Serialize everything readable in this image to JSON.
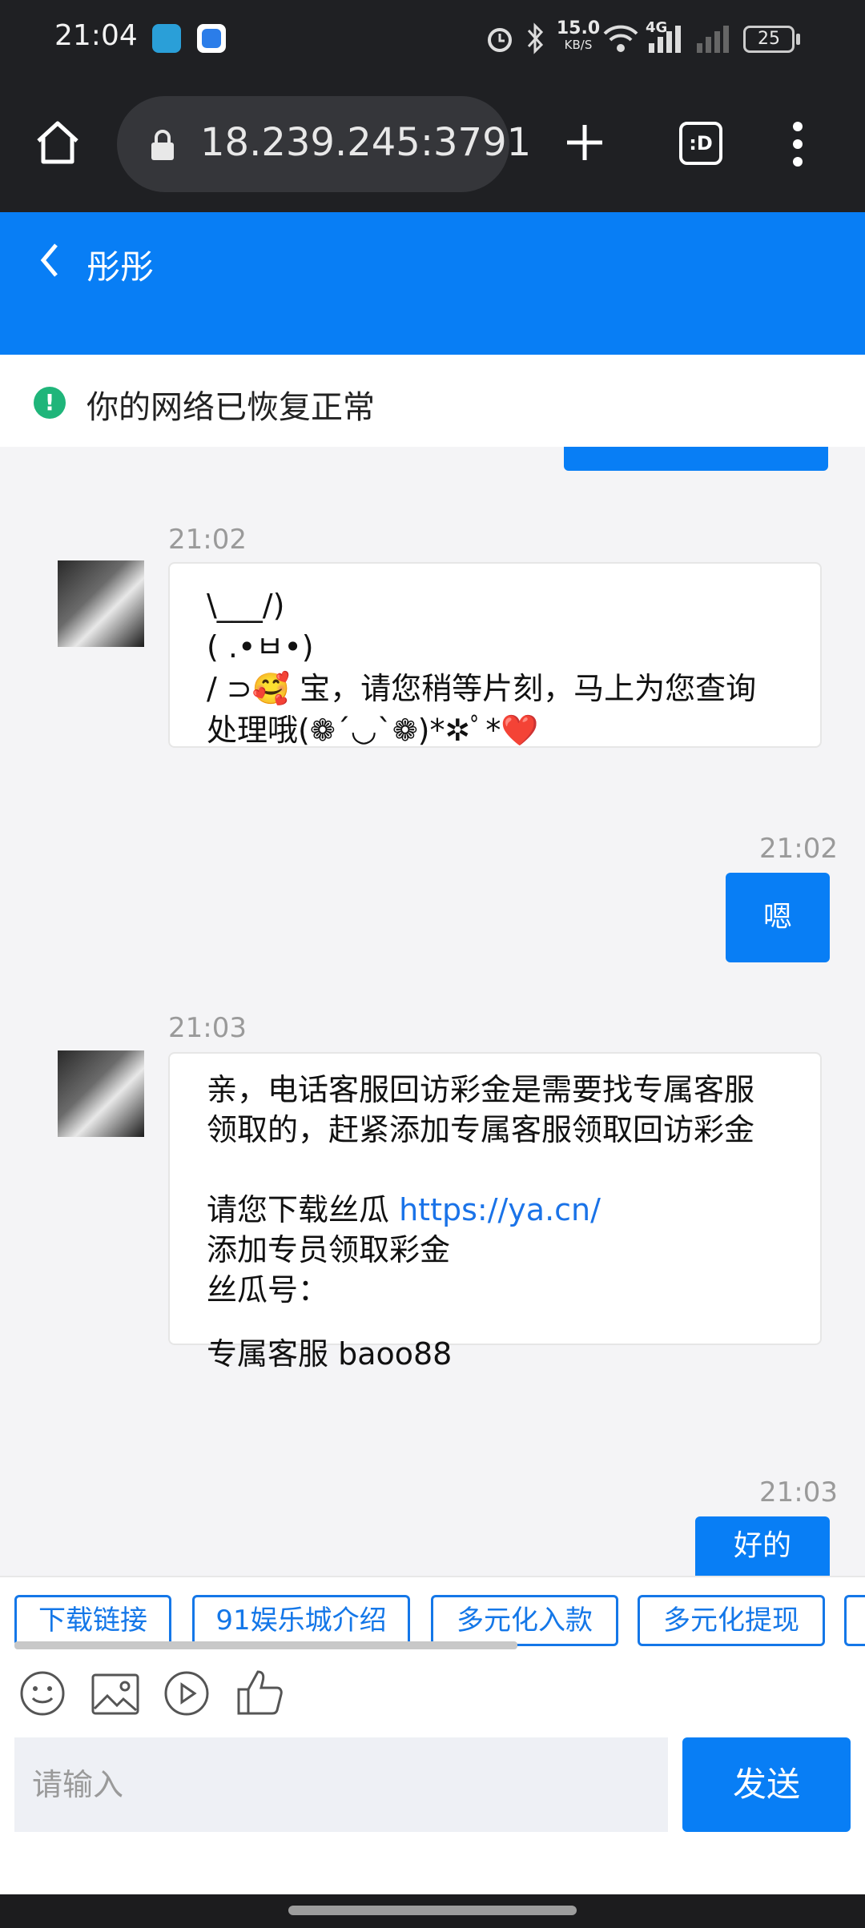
{
  "status_bar": {
    "time": "21:04",
    "net_speed": "15.0",
    "net_unit": "KB/S",
    "signal_tag": "4G",
    "battery": "25"
  },
  "browser": {
    "url": "18.239.245:3791"
  },
  "header": {
    "title": "彤彤"
  },
  "network_banner": {
    "text": "你的网络已恢复正常"
  },
  "messages": [
    {
      "time": "21:02",
      "lines": [
        "\\___/)",
        "( .•ㅂ•)",
        "/ ⊃🥰 宝，请您稍等片刻，马上为您查询",
        "处理哦(❁´◡`❁)*✲ﾟ*❤️"
      ]
    },
    {
      "time": "21:02",
      "text": "嗯"
    },
    {
      "time": "21:03",
      "lines": [
        "亲，电话客服回访彩金是需要找专属客服",
        "领取的，赶紧添加专属客服领取回访彩金",
        "",
        "请您下载丝瓜 ",
        "添加专员领取彩金",
        "丝瓜号：",
        "",
        "专属客服 baoo88"
      ],
      "link": "https://ya.cn/"
    },
    {
      "time": "21:03",
      "text": "好的"
    }
  ],
  "quick_tags": [
    "下载链接",
    "91娱乐城介绍",
    "多元化入款",
    "多元化提现"
  ],
  "input": {
    "placeholder": "请输入",
    "send_label": "发送"
  },
  "icons": {
    "emoji": "smiley-icon",
    "image": "image-icon",
    "video": "play-icon",
    "like": "thumbs-up-icon"
  }
}
